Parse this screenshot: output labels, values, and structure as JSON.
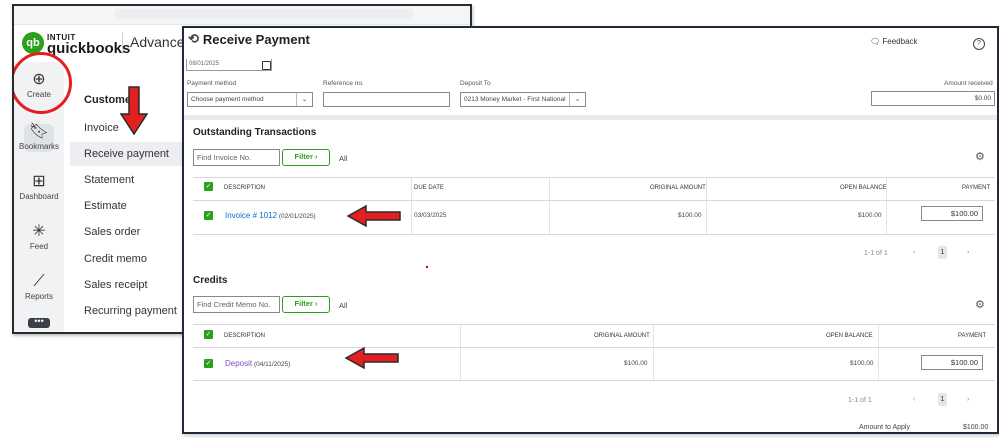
{
  "qb": {
    "brand_top": "INTUIT",
    "brand_name": "quickbooks",
    "plan": "Advanced",
    "sidebar": [
      {
        "label": "Create",
        "icon": "plus-circle-icon"
      },
      {
        "label": "Bookmarks",
        "icon": "bookmark-icon"
      },
      {
        "label": "Dashboard",
        "icon": "dashboard-icon"
      },
      {
        "label": "Feed",
        "icon": "sparkle-icon"
      },
      {
        "label": "Reports",
        "icon": "chart-line-icon"
      },
      {
        "label": "",
        "icon": "more-icon"
      }
    ],
    "menu_header": "Customer",
    "menu_items": [
      "Invoice",
      "Receive payment",
      "Statement",
      "Estimate",
      "Sales order",
      "Credit memo",
      "Sales receipt",
      "Recurring payment"
    ],
    "selected_item": "Receive payment"
  },
  "dialog": {
    "title": "Receive Payment",
    "feedback": "Feedback",
    "help": "?",
    "date_value": "08/01/2025",
    "payment_method": {
      "label": "Payment method",
      "value": "Choose payment method"
    },
    "reference": {
      "label": "Reference no.",
      "value": ""
    },
    "deposit_to": {
      "label": "Deposit To",
      "value": "0213 Money Market - First National"
    },
    "amount_received": {
      "label": "Amount received",
      "value": "$0.00"
    },
    "outstanding": {
      "title": "Outstanding Transactions",
      "find_placeholder": "Find Invoice No.",
      "filter_label": "Filter",
      "all_label": "All",
      "columns": [
        "DESCRIPTION",
        "DUE DATE",
        "ORIGINAL AMOUNT",
        "OPEN BALANCE",
        "PAYMENT"
      ],
      "rows": [
        {
          "link": "Invoice # 1012",
          "date": "(02/01/2025)",
          "due_date": "03/03/2025",
          "original": "$100.00",
          "open": "$100.00",
          "payment": "$100.00"
        }
      ],
      "pager": "1-1 of 1",
      "page": "1"
    },
    "credits": {
      "title": "Credits",
      "find_placeholder": "Find Credit Memo No.",
      "filter_label": "Filter",
      "all_label": "All",
      "columns": [
        "DESCRIPTION",
        "ORIGINAL AMOUNT",
        "OPEN BALANCE",
        "PAYMENT"
      ],
      "rows": [
        {
          "link": "Deposit",
          "date": "(04/11/2025)",
          "original": "$100.00",
          "open": "$100.00",
          "payment": "$100.00"
        }
      ],
      "pager": "1-1 of 1",
      "page": "1"
    },
    "amount_to_apply": {
      "label": "Amount to Apply",
      "value": "$100.00"
    }
  },
  "colors": {
    "brand_green": "#2ca01c",
    "annotation_red": "#e41f1f",
    "link_blue": "#0b6cd6",
    "link_purple": "#7b4bc4"
  }
}
